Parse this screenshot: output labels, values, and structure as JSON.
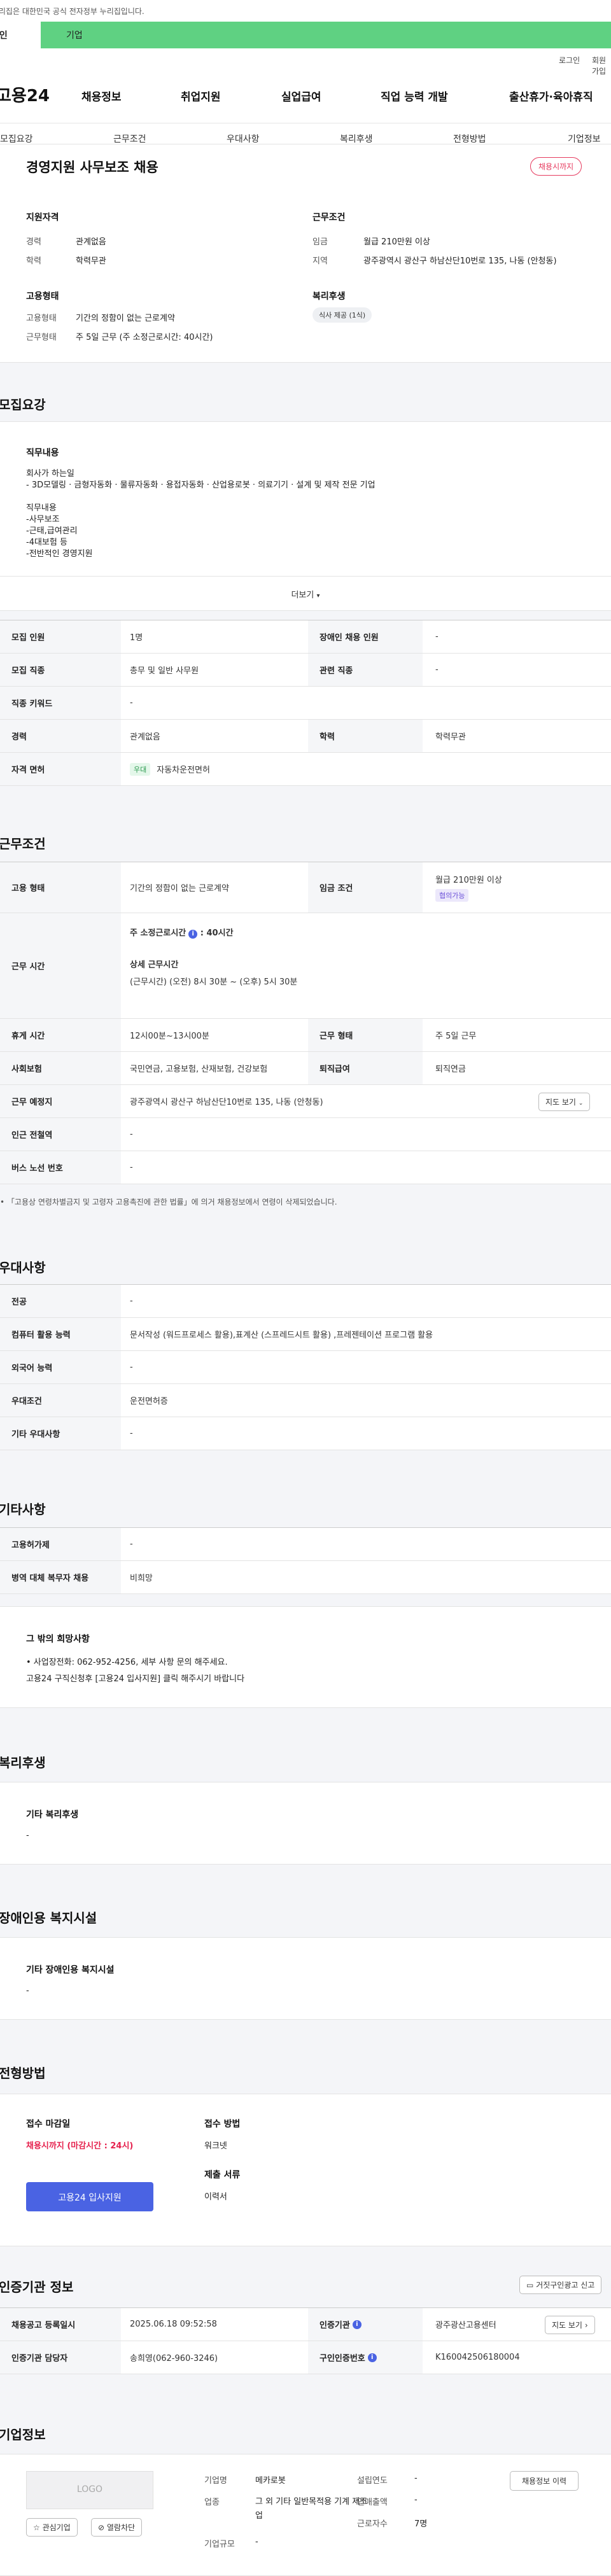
{
  "notice": "이 누리집은 대한민국 공식 전자정부 누리집입니다.",
  "tabs": {
    "individual": "개인",
    "company": "기업"
  },
  "util": {
    "login": "로그인",
    "join": "회원가입"
  },
  "logo": "고용24",
  "gnb": [
    "채용정보",
    "취업지원",
    "실업급여",
    "직업 능력 개발",
    "출산휴가·육아휴직"
  ],
  "subnav": [
    "모집요강",
    "근무조건",
    "우대사항",
    "복리후생",
    "전형방법",
    "기업정보"
  ],
  "summary": {
    "title": "경영지원 사무보조 채용",
    "status": "채용시까지",
    "qual_title": "지원자격",
    "cond_title": "근무조건",
    "career_label": "경력",
    "career": "관계없음",
    "edu_label": "학력",
    "edu": "학력무관",
    "wage_label": "임금",
    "wage": "월급 210만원 이상",
    "region_label": "지역",
    "region": "광주광역시 광산구 하남산단10번로 135, 나동 (안청동)",
    "emp_title": "고용형태",
    "emp_label": "고용형태",
    "emp": "기간의 정함이 없는 근로계약",
    "work_label": "근무형태",
    "work": "주 5일 근무 (주 소정근로시간: 40시간)",
    "welfare_title": "복리후생",
    "welfare_chip": "식사 제공 (1식)"
  },
  "recruit": {
    "section": "모집요강",
    "job_title": "직무내용",
    "job_lines": [
      "회사가 하는일",
      "- 3D모델링 · 금형자동화 · 물류자동화 · 용접자동화 · 산업용로봇 · 의료기기 · 설계 및 제작 전문 기업",
      "",
      "직무내용",
      "-사무보조",
      "-근태,급여관리",
      "-4대보험 등",
      "-전반적인 경영지원"
    ],
    "more": "더보기",
    "rows": [
      {
        "l1": "모집 인원",
        "v1": "1명",
        "l2": "장애인 채용 인원",
        "v2": "-"
      },
      {
        "l1": "모집 직종",
        "v1": "총무 및 일반 사무원",
        "l2": "관련 직종",
        "v2": "-"
      },
      {
        "l1": "직종 키워드",
        "v1": "-"
      },
      {
        "l1": "경력",
        "v1": "관계없음",
        "l2": "학력",
        "v2": "학력무관"
      },
      {
        "l1": "자격 면허",
        "tag": "우대",
        "v1": "자동차운전면허"
      }
    ]
  },
  "conditions": {
    "section": "근무조건",
    "emp_label": "고용 형태",
    "emp": "기간의 정함이 없는 근로계약",
    "wage_label": "임금 조건",
    "wage": "월급 210만원 이상",
    "wage_tag": "협의가능",
    "hours_label": "근무 시간",
    "hours_sub": "주 소정근로시간",
    "hours_val": "40시간",
    "detail_title": "상세 근무시간",
    "detail": "(근무시간) (오전) 8시 30분 ~ (오후) 5시 30분",
    "rest_label": "휴게 시간",
    "rest": "12시00분~13시00분",
    "type_label": "근무 형태",
    "type": "주 5일 근무",
    "ins_label": "사회보험",
    "ins": "국민연금, 고용보험, 산재보험, 건강보험",
    "ret_label": "퇴직급여",
    "ret": "퇴직연금",
    "place_label": "근무 예정지",
    "place": "광주광역시 광산구 하남산단10번로 135, 나동 (안청동)",
    "map_btn": "지도 보기",
    "subway_label": "인근 전철역",
    "subway": "-",
    "bus_label": "버스 노선 번호",
    "bus": "-",
    "note": "「고용상 연령차별금지 및 고령자 고용촉진에 관한 법률」에 의거 채용정보에서 연령이 삭제되었습니다."
  },
  "pref": {
    "section": "우대사항",
    "rows": [
      {
        "l": "전공",
        "v": "-"
      },
      {
        "l": "컴퓨터 활용 능력",
        "v": "문서작성 (워드프로세스 활용),표계산 (스프레드시트 활용) ,프레젠테이션 프로그램 활용"
      },
      {
        "l": "외국어 능력",
        "v": "-"
      },
      {
        "l": "우대조건",
        "v": "운전면허증"
      },
      {
        "l": "기타 우대사항",
        "v": "-"
      }
    ]
  },
  "etc": {
    "section": "기타사항",
    "rows": [
      {
        "l": "고용허가제",
        "v": "-"
      },
      {
        "l": "병역 대체 복무자 채용",
        "v": "비희망"
      }
    ],
    "box_title": "그 밖의 희망사항",
    "box_lines": [
      "• 사업장전화: 062-952-4256, 세부 사항 문의 해주세요.",
      "   고용24 구직신청후 [고용24 입사지원] 클릭 해주시기 바랍니다"
    ]
  },
  "welfare": {
    "section": "복리후생",
    "box_title": "기타 복리후생",
    "box_val": "-"
  },
  "disability": {
    "section": "장애인용 복지시설",
    "box_title": "기타 장애인용 복지시설",
    "box_val": "-"
  },
  "selection": {
    "section": "전형방법",
    "deadline_title": "접수 마감일",
    "deadline": "채용시까지 (마감시간 : 24시)",
    "apply_btn": "고용24 입사지원",
    "method_title": "접수 방법",
    "method": "워크넷",
    "docs_title": "제출 서류",
    "docs": "이력서"
  },
  "agency": {
    "section": "인증기관 정보",
    "report_btn": "거짓구인광고 신고",
    "reg_label": "채용공고 등록일시",
    "reg": "2025.06.18 09:52:58",
    "org_label": "인증기관",
    "org": "광주광산고용센터",
    "map_btn": "지도 보기",
    "mgr_label": "인증기관 담당자",
    "mgr": "송희영(062-960-3246)",
    "no_label": "구인인증번호",
    "no": "K160042506180004"
  },
  "company": {
    "section": "기업정보",
    "logo": "LOGO",
    "fav_btn": "관심기업",
    "block_btn": "열람차단",
    "name_label": "기업명",
    "name": "메카로봇",
    "ind_label": "업종",
    "ind": "그 외 기타 일반목적용 기계 제조업",
    "size_label": "기업규모",
    "size": "-",
    "est_label": "설립연도",
    "est": "-",
    "sales_label": "연매출액",
    "sales": "-",
    "emp_label": "근로자수",
    "emp": "7명",
    "history_btn": "채용정보 이력"
  }
}
